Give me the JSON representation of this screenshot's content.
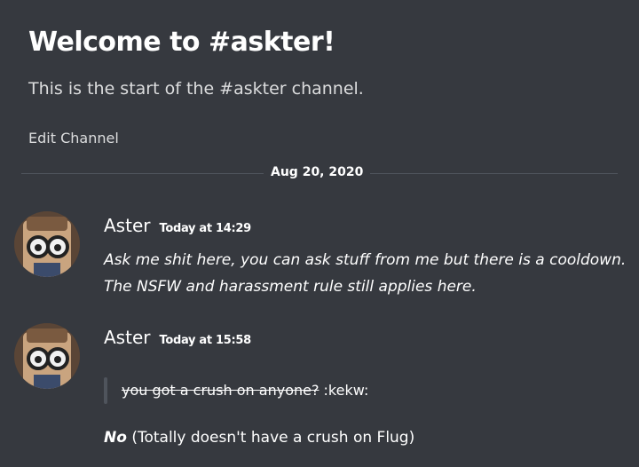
{
  "channel": {
    "welcome_title": "Welcome to #askter!",
    "welcome_subtitle": "This is the start of the #askter channel.",
    "edit_label": "Edit Channel"
  },
  "divider": {
    "date": "Aug 20, 2020"
  },
  "messages": [
    {
      "username": "Aster",
      "timestamp": "Today at 14:29",
      "text": "Ask me shit here, you can ask stuff from me but there is a cooldown. The NSFW and harassment rule still applies here."
    },
    {
      "username": "Aster",
      "timestamp": "Today at 15:58",
      "quote_strike": "you got a crush on anyone?",
      "quote_rest": " :kekw:",
      "reply_bold": "No",
      "reply_rest": " (Totally doesn't have a crush on Flug)"
    }
  ],
  "colors": {
    "background": "#36393f",
    "text": "#dcddde",
    "white": "#ffffff",
    "divider": "#4f545c"
  },
  "icons": {
    "avatar": "avatar-character-glasses"
  }
}
